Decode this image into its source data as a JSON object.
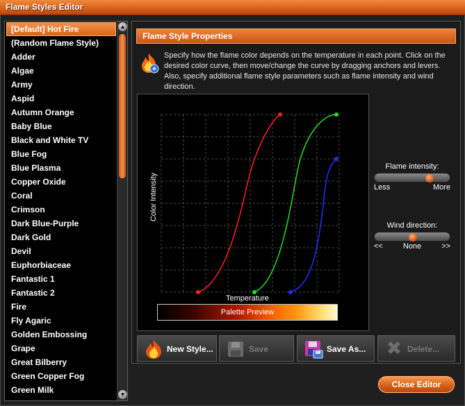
{
  "window": {
    "title": "Flame Styles Editor"
  },
  "flame_styles": {
    "selected_index": 0,
    "items": [
      "[Default] Hot Fire",
      "(Random Flame Style)",
      "Adder",
      "Algae",
      "Army",
      "Aspid",
      "Autumn Orange",
      "Baby Blue",
      "Black and White TV",
      "Blue Fog",
      "Blue Plasma",
      "Copper Oxide",
      "Coral",
      "Crimson",
      "Dark Blue-Purple",
      "Dark Gold",
      "Devil",
      "Euphorbiaceae",
      "Fantastic 1",
      "Fantastic 2",
      "Fire",
      "Fly Agaric",
      "Golden Embossing",
      "Grape",
      "Great Bilberry",
      "Green Copper Fog",
      "Green Milk"
    ]
  },
  "properties": {
    "header": "Flame Style Properties",
    "description": "Specify how the flame color depends on the temperature in each point. Click on the desired color curve, then move/change the curve by dragging anchors and levers. Also, specify additional flame style parameters such as flame intensity and wind direction."
  },
  "graph": {
    "y_label": "Color Intensity",
    "x_label": "Temperature",
    "palette_label": "Palette Preview",
    "curve_colors": {
      "red": "#ff2020",
      "green": "#20e020",
      "blue": "#2030ff"
    }
  },
  "flame_intensity": {
    "label": "Flame intensity:",
    "min_label": "Less",
    "max_label": "More",
    "value": 0.75
  },
  "wind_direction": {
    "label": "Wind direction:",
    "min_label": "<<",
    "center_label": "None",
    "max_label": ">>",
    "value": 0.5
  },
  "buttons": {
    "new_style": "New Style...",
    "save": "Save",
    "save_as": "Save As...",
    "delete": "Delete...",
    "close": "Close Editor"
  },
  "colors": {
    "accent": "#e06a22",
    "background": "#1f1f1f"
  }
}
